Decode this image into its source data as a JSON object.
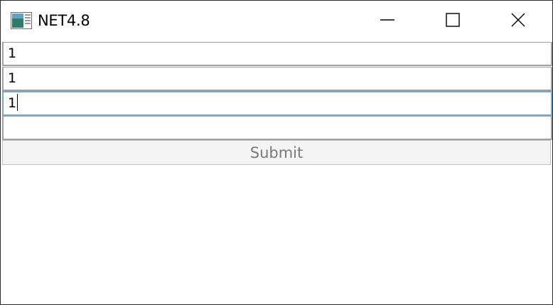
{
  "window": {
    "title": "NET4.8",
    "controls": {
      "minimize": "minimize-icon",
      "maximize": "maximize-icon",
      "close": "close-icon"
    }
  },
  "form": {
    "fields": [
      {
        "value": "1"
      },
      {
        "value": "1"
      },
      {
        "value": "1",
        "focused": true
      },
      {
        "value": ""
      }
    ],
    "submit_label": "Submit",
    "submit_enabled": false
  },
  "colors": {
    "focus_border": "#7aa6d6",
    "field_border": "#a0a0a0",
    "disabled_text": "#7a7a7a"
  }
}
